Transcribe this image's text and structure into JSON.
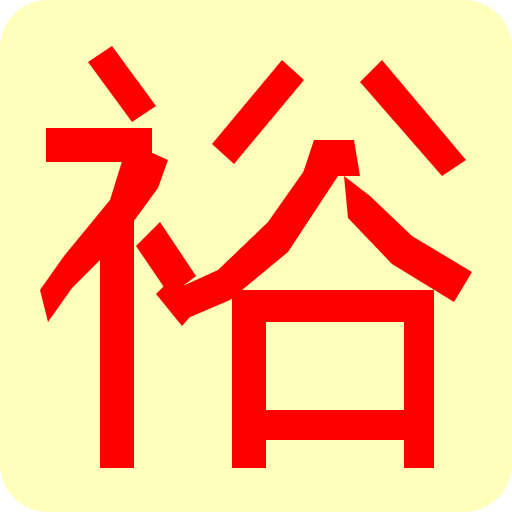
{
  "icon": {
    "character": "裕",
    "background_color": "#FFFFBB",
    "glyph_color": "#FF0000"
  }
}
